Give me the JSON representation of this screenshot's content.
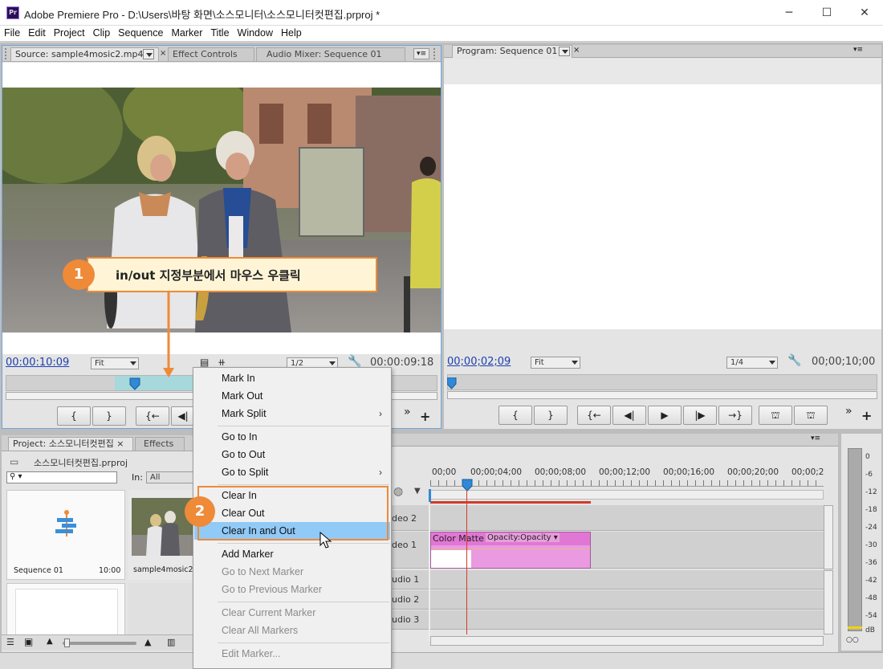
{
  "window": {
    "title": "Adobe Premiere Pro - D:\\Users\\바탕 화면\\소스모니터\\소스모니터컷편집.prproj *",
    "app_icon": "Pr",
    "controls": [
      "─",
      "☐",
      "✕"
    ]
  },
  "menubar": [
    "File",
    "Edit",
    "Project",
    "Clip",
    "Sequence",
    "Marker",
    "Title",
    "Window",
    "Help"
  ],
  "source_panel": {
    "tab_label": "Source: sample4mosic2.mp4",
    "tabs": [
      "Effect Controls",
      "Audio Mixer: Sequence 01"
    ],
    "timecode_current": "00:00:10:09",
    "zoom": "Fit",
    "resolution": "1/2",
    "duration": "00:00:09:18",
    "buttons": [
      "{",
      "}",
      "{←",
      "◀|",
      "▶"
    ]
  },
  "program_panel": {
    "tab_label": "Program: Sequence 01",
    "timecode_current": "00;00;02;09",
    "zoom": "Fit",
    "resolution": "1/4",
    "duration": "00;00;10;00",
    "buttons": [
      "{",
      "}",
      "{←",
      "◀|",
      "▶",
      "|▶",
      "→}"
    ]
  },
  "project_panel": {
    "tab_label": "Project: 소스모니터컷편집",
    "tab2": "Effects",
    "file": "소스모니터컷편집.prproj",
    "in_label": "In:",
    "in_value": "All",
    "items": [
      {
        "name": "Sequence 01",
        "duration": "10:00"
      },
      {
        "name": "sample4mosic2.mp"
      }
    ]
  },
  "timeline": {
    "ruler": [
      "00;00",
      "00;00;04;00",
      "00;00;08;00",
      "00;00;12;00",
      "00;00;16;00",
      "00;00;20;00",
      "00;00;2"
    ],
    "tracks": [
      "deo 2",
      "deo 1",
      "udio 1",
      "udio 2",
      "udio 3"
    ],
    "clip_label": "Color Matte",
    "clip_effect": "Opacity:Opacity"
  },
  "audio_meter": {
    "labels": [
      "0",
      "-6",
      "-12",
      "-18",
      "-24",
      "-30",
      "-36",
      "-42",
      "-48",
      "-54",
      "dB"
    ]
  },
  "context_menu": {
    "items": [
      {
        "label": "Mark In",
        "state": "normal"
      },
      {
        "label": "Mark Out",
        "state": "normal"
      },
      {
        "label": "Mark Split",
        "state": "normal",
        "submenu": true
      },
      {
        "label": "Go to In",
        "state": "normal"
      },
      {
        "label": "Go to Out",
        "state": "normal"
      },
      {
        "label": "Go to Split",
        "state": "normal",
        "submenu": true
      },
      {
        "label": "Clear In",
        "state": "normal"
      },
      {
        "label": "Clear Out",
        "state": "normal"
      },
      {
        "label": "Clear In and Out",
        "state": "highlighted"
      },
      {
        "label": "Add Marker",
        "state": "normal"
      },
      {
        "label": "Go to Next Marker",
        "state": "disabled"
      },
      {
        "label": "Go to Previous Marker",
        "state": "disabled"
      },
      {
        "label": "Clear Current Marker",
        "state": "disabled"
      },
      {
        "label": "Clear All Markers",
        "state": "disabled"
      },
      {
        "label": "Edit Marker...",
        "state": "disabled"
      }
    ]
  },
  "callouts": [
    {
      "number": "1",
      "text": "in/out 지정부분에서 마우스 우클릭"
    },
    {
      "number": "2",
      "text": ""
    }
  ],
  "colors": {
    "accent_orange": "#ef8a38",
    "timecode_blue": "#1e40af",
    "menu_highlight": "#91c9f7",
    "clip_pink": "#e99ae0",
    "in_out_range": "#a7d8dc",
    "timeline_red": "#d23b2b"
  }
}
